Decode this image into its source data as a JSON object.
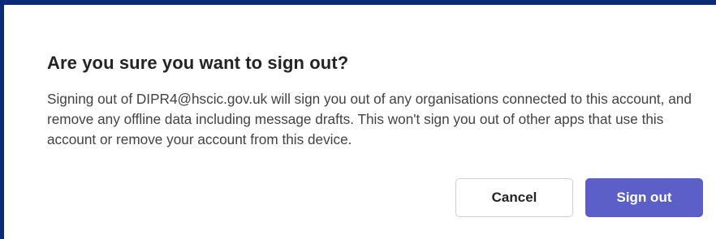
{
  "dialog": {
    "title": "Are you sure you want to sign out?",
    "message": "Signing out of DIPR4@hscic.gov.uk will sign you out of any organisations connected to this account, and remove any offline data including message drafts. This won't sign you out of other apps that use this account or remove your account from this device.",
    "cancel_label": "Cancel",
    "confirm_label": "Sign out"
  },
  "colors": {
    "border": "#0b2a78",
    "primary_button": "#5b5fc7",
    "title_text": "#242424",
    "body_text": "#424242"
  }
}
